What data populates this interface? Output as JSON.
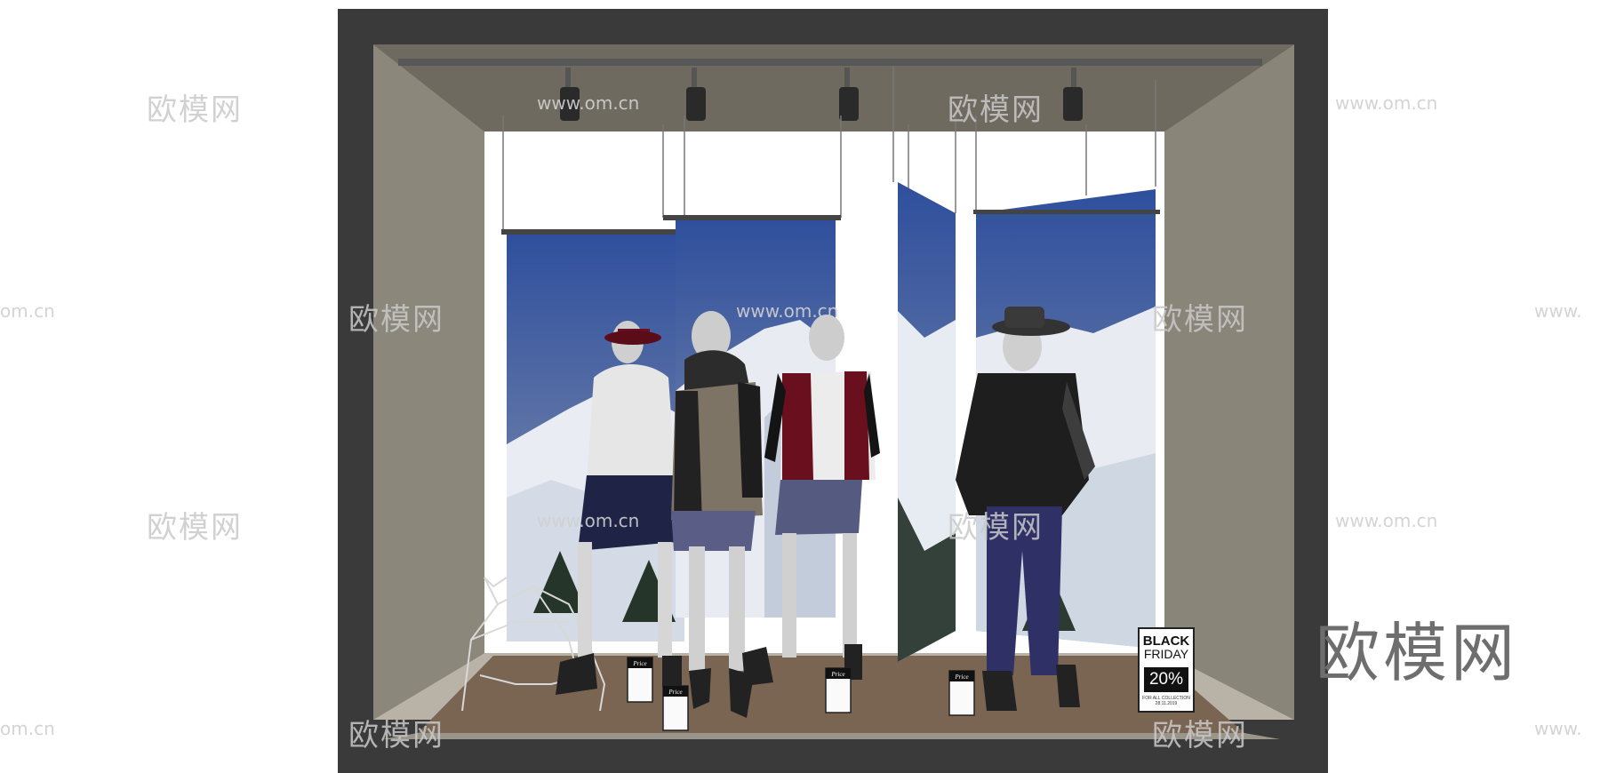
{
  "watermarks": {
    "brand": "欧模网",
    "url_www": "www.om.cn",
    "url_short": "www.om.cn",
    "edge_url_left": "om.cn",
    "edge_url_right": "www."
  },
  "price_tag_label": "Price",
  "promo_sign": {
    "line1": "BLACK",
    "line2": "FRIDAY",
    "discount": "20%",
    "note": "FOR ALL COLLECTION",
    "date": "28.11.2019"
  },
  "colors": {
    "frame": "#3b3b3b",
    "wall": "#8a8578",
    "ceiling": "#6f6a5f",
    "floor": "#7a6553",
    "sky": "#3b5aa8",
    "snow": "#e8edf4"
  }
}
